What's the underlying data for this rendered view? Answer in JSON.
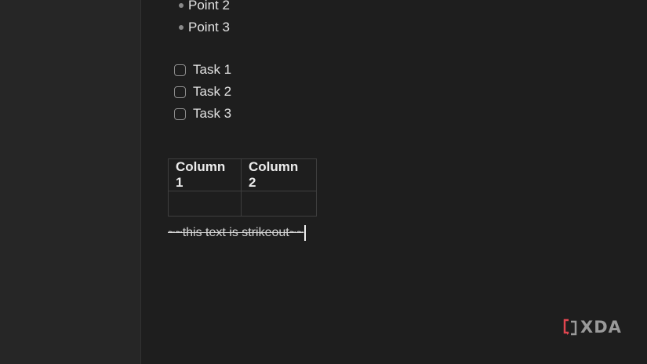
{
  "editor": {
    "bullets": [
      {
        "label": "Point 2"
      },
      {
        "label": "Point 3"
      }
    ],
    "tasks": [
      {
        "label": "Task 1",
        "checked": false
      },
      {
        "label": "Task 2",
        "checked": false
      },
      {
        "label": "Task 3",
        "checked": false
      }
    ],
    "table": {
      "headers": [
        "Column 1",
        "Column 2"
      ],
      "rows": [
        [
          "",
          ""
        ]
      ]
    },
    "strikeout_line": "~~this text is strikeout~~"
  },
  "watermark": {
    "text": "XDA",
    "accent_color": "#e0454f"
  }
}
